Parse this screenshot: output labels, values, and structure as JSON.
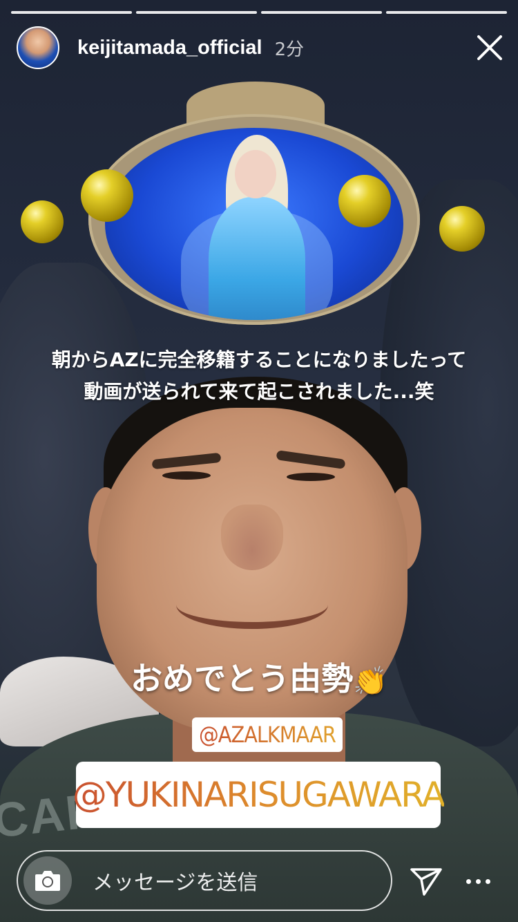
{
  "story": {
    "progress_segments": [
      {
        "state": "done"
      },
      {
        "state": "done"
      },
      {
        "state": "done"
      },
      {
        "state": "done"
      }
    ],
    "progress_active_index": 3,
    "username": "keijitamada_official",
    "time_ago": "2分",
    "close_icon": "close-icon"
  },
  "overlay": {
    "caption_line1": "朝からAZに完全移籍することになりましたって",
    "caption_line2": "動画が送られて来て起こされました...笑",
    "big_text": "おめでとう由勢",
    "big_text_emoji": "👏",
    "mention_small": "@AZALKMAAR",
    "mention_big": "@YUKINARISUGAWARA"
  },
  "footer": {
    "camera_icon": "camera-icon",
    "reply_placeholder": "メッセージを送信",
    "send_icon": "send-icon",
    "more_icon": "more-icon"
  }
}
